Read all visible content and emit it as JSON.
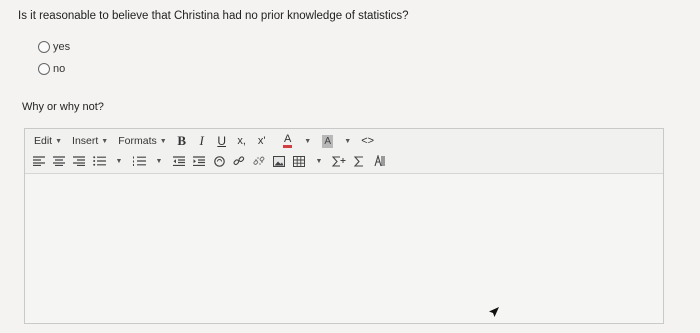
{
  "question": {
    "text": "Is it reasonable to believe that Christina had no prior knowledge of statistics?",
    "options": [
      {
        "label": "yes",
        "selected": false
      },
      {
        "label": "no",
        "selected": false
      }
    ]
  },
  "followup": {
    "prompt": "Why or why not?"
  },
  "editor": {
    "menus": {
      "edit": "Edit",
      "insert": "Insert",
      "formats": "Formats"
    },
    "format_buttons": {
      "bold": "B",
      "italic": "I",
      "underline": "U",
      "subscript": "x,",
      "superscript": "x'",
      "text_color": "A",
      "background_color": "A",
      "source_code": "<>"
    },
    "content": "",
    "colors": {
      "text_color_bar": "#d04040"
    }
  }
}
